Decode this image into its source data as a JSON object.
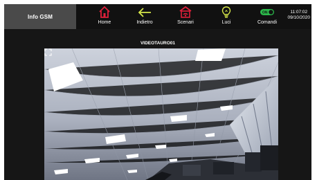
{
  "header": {
    "info_tab": "Info GSM",
    "nav": [
      {
        "label": "Home",
        "icon": "home-icon",
        "color": "#e0203a"
      },
      {
        "label": "Indietro",
        "icon": "back-arrow-icon",
        "color": "#d7e84a"
      },
      {
        "label": "Scenari",
        "icon": "scenes-icon",
        "color": "#e0203a"
      },
      {
        "label": "Luci",
        "icon": "lightbulb-icon",
        "color": "#d7e84a"
      },
      {
        "label": "Comandi",
        "icon": "toggle-on-icon",
        "color": "#2bb84a",
        "badge": "ON"
      }
    ],
    "clock": {
      "time": "11:07:02",
      "date": "09/10/2020"
    }
  },
  "camera": {
    "title": "VIDEOTAURO01",
    "fullscreen_icon": "fullscreen-icon"
  }
}
